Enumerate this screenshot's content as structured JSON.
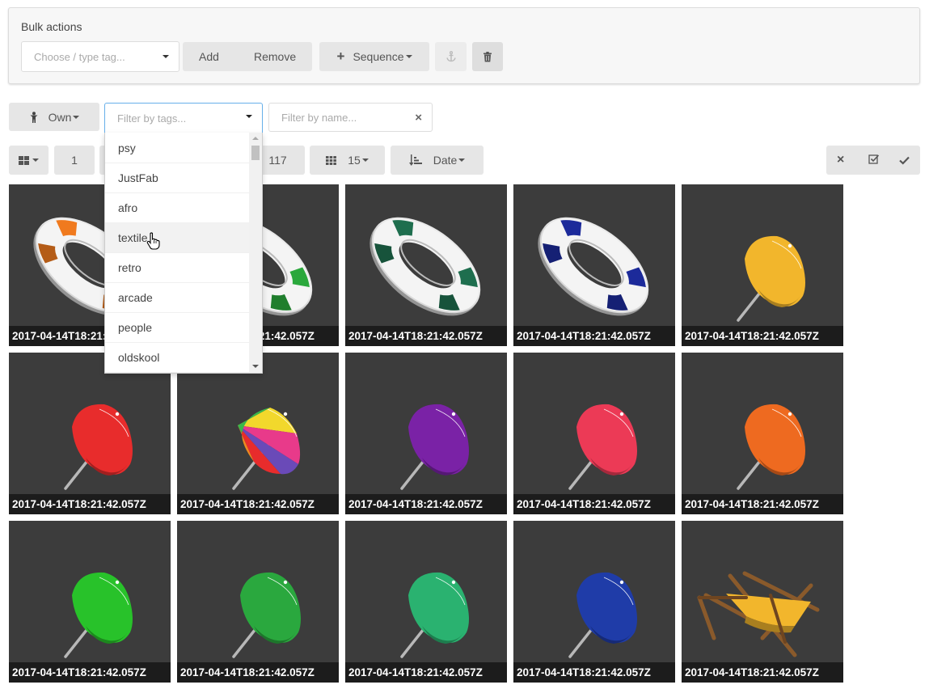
{
  "bulk": {
    "title": "Bulk actions",
    "tag_placeholder": "Choose / type tag...",
    "add_label": "Add",
    "remove_label": "Remove",
    "sequence_label": "Sequence"
  },
  "filters": {
    "own_label": "Own",
    "tags_placeholder": "Filter by tags...",
    "name_placeholder": "Filter by name..."
  },
  "toolbar": {
    "page_label": "1",
    "total_label": "117",
    "per_page_label": "15",
    "sort_label": "Date"
  },
  "tag_options": [
    "psy",
    "JustFab",
    "afro",
    "textile",
    "retro",
    "arcade",
    "people",
    "oldskool"
  ],
  "tiles": [
    {
      "caption": "2017-04-14T18:21:42.057Z",
      "kind": "ring",
      "color": "#f07a1e"
    },
    {
      "caption": "2017-04-14T18:21:42.057Z",
      "kind": "ring",
      "color": "#2aa83c"
    },
    {
      "caption": "2017-04-14T18:21:42.057Z",
      "kind": "ring",
      "color": "#1e6e4e"
    },
    {
      "caption": "2017-04-14T18:21:42.057Z",
      "kind": "ring",
      "color": "#1c2a9a"
    },
    {
      "caption": "2017-04-14T18:21:42.057Z",
      "kind": "umbrella",
      "color": "#f2b62c"
    },
    {
      "caption": "2017-04-14T18:21:42.057Z",
      "kind": "umbrella",
      "color": "#e82c2c"
    },
    {
      "caption": "2017-04-14T18:21:42.057Z",
      "kind": "umbrella-rainbow",
      "color": "#e8a02c"
    },
    {
      "caption": "2017-04-14T18:21:42.057Z",
      "kind": "umbrella",
      "color": "#7a22a6"
    },
    {
      "caption": "2017-04-14T18:21:42.057Z",
      "kind": "umbrella",
      "color": "#ec3a56"
    },
    {
      "caption": "2017-04-14T18:21:42.057Z",
      "kind": "umbrella",
      "color": "#ee6a20"
    },
    {
      "caption": "2017-04-14T18:21:42.057Z",
      "kind": "umbrella",
      "color": "#28c22a"
    },
    {
      "caption": "2017-04-14T18:21:42.057Z",
      "kind": "umbrella",
      "color": "#2aa83e"
    },
    {
      "caption": "2017-04-14T18:21:42.057Z",
      "kind": "umbrella",
      "color": "#2ab270"
    },
    {
      "caption": "2017-04-14T18:21:42.057Z",
      "kind": "umbrella",
      "color": "#1f3ca8"
    },
    {
      "caption": "2017-04-14T18:21:42.057Z",
      "kind": "deckchair",
      "color": "#f2b62c"
    }
  ]
}
